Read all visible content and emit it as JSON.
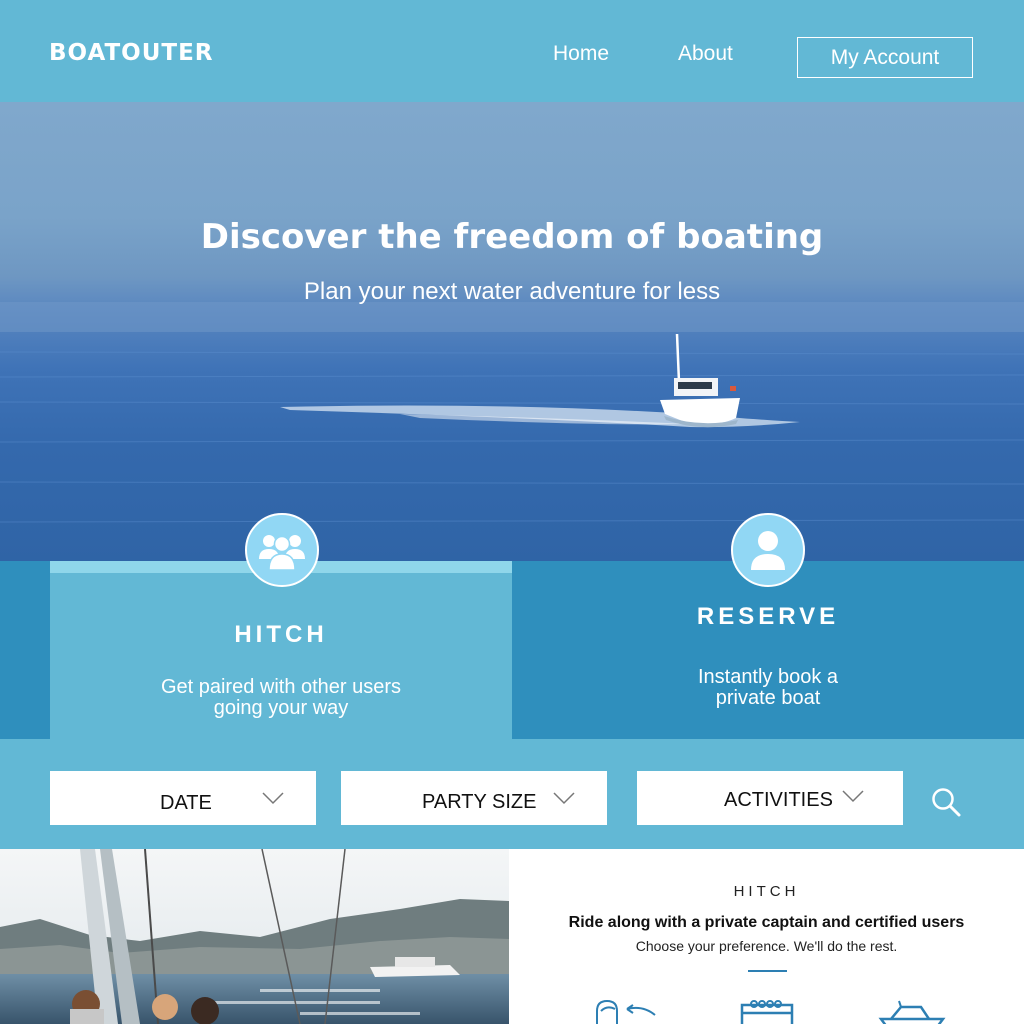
{
  "header": {
    "logo": "BOATOUTER",
    "nav": {
      "home": "Home",
      "about": "About"
    },
    "account_button": "My Account"
  },
  "hero": {
    "title": "Discover the freedom of boating",
    "subtitle": "Plan your next water adventure for less"
  },
  "cards": {
    "hitch": {
      "title": "HITCH",
      "desc_line1": "Get paired with other users",
      "desc_line2": "going your way",
      "icon": "group-icon"
    },
    "reserve": {
      "title": "RESERVE",
      "desc_line1": "Instantly book a",
      "desc_line2": "private boat",
      "icon": "user-icon"
    }
  },
  "search": {
    "date": "DATE",
    "party_size": "PARTY SIZE",
    "activities": "ACTIVITIES",
    "search_icon": "search-icon"
  },
  "info": {
    "label": "HITCH",
    "headline": "Ride along with a private captain and certified users",
    "text": "Choose your preference. We'll do the rest.",
    "icons": [
      "person-icon",
      "calendar-icon",
      "boat-icon"
    ]
  },
  "colors": {
    "header": "#62b8d5",
    "card_dark": "#2f8fbd",
    "card_light": "#62b8d5",
    "accent": "#2d7fb3"
  }
}
